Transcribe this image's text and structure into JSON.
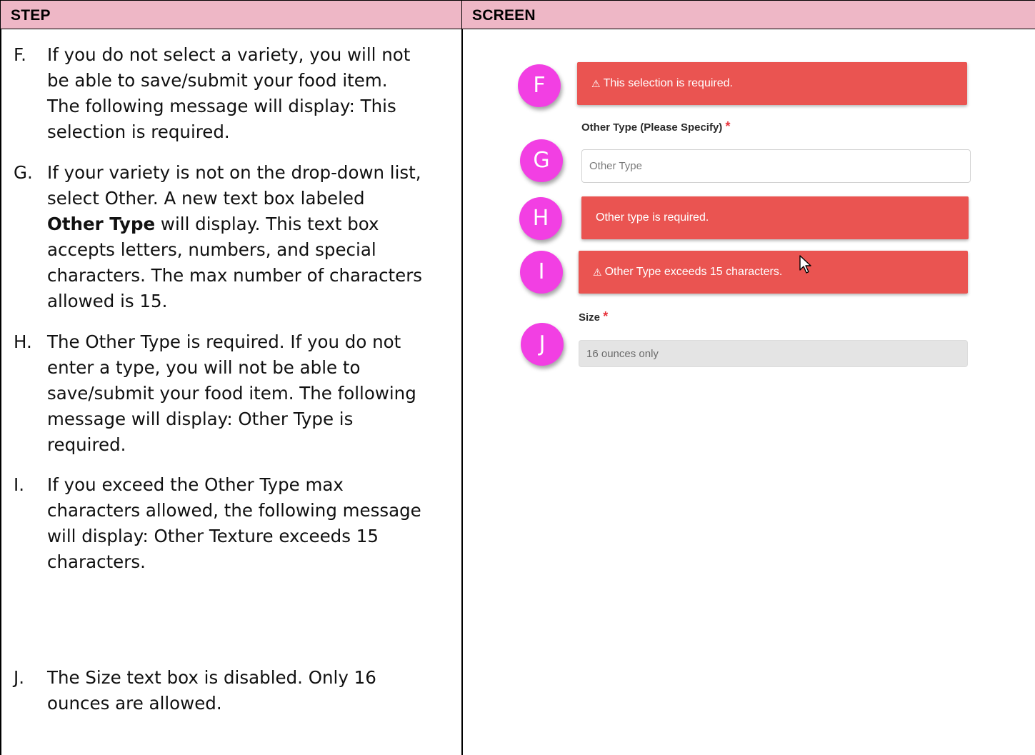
{
  "header": {
    "step": "STEP",
    "screen": "SCREEN"
  },
  "steps": [
    {
      "letter": "F.",
      "lines": [
        "If you do not select a variety, you will not",
        "be able to save/submit your food item.",
        "The following message will display:  This",
        "selection is required."
      ]
    },
    {
      "letter": "G.",
      "lines": [
        "If your variety is not on the drop-down list,",
        "select Other.  A new text box labeled",
        "Other Type will display.  This text box",
        "accepts letters, numbers, and special",
        "characters.  The max number of characters",
        "allowed is 15."
      ],
      "bold_phrase": "Other Type"
    },
    {
      "letter": "H.",
      "lines": [
        "The Other Type is required. If you do not",
        "enter a type, you will not be able to",
        "save/submit your food item. The following",
        "message will display:  Other Type is",
        "required."
      ]
    },
    {
      "letter": "I.",
      "lines": [
        "If you exceed the Other Type max",
        "characters allowed, the following message",
        "will display:  Other Texture exceeds 15",
        "characters."
      ]
    },
    {
      "letter": "J.",
      "lines": [
        "The Size text box is disabled.  Only 16",
        "ounces are allowed."
      ]
    }
  ],
  "screen": {
    "badges": [
      "F",
      "G",
      "H",
      "I",
      "J"
    ],
    "alert_f": {
      "icon": "⚠",
      "text": "This selection is required."
    },
    "other_type_label": "Other Type (Please Specify)",
    "required_mark": "*",
    "other_type_placeholder": "Other Type",
    "alert_h": {
      "text": "Other type is required."
    },
    "alert_i": {
      "icon": "⚠",
      "text": "Other Type exceeds 15 characters."
    },
    "size_label": "Size",
    "size_value": "16 ounces only"
  },
  "colors": {
    "header_bg": "#eeb7c6",
    "badge": "#f23fe3",
    "alert": "#ea5451",
    "required": "#e8323b"
  }
}
